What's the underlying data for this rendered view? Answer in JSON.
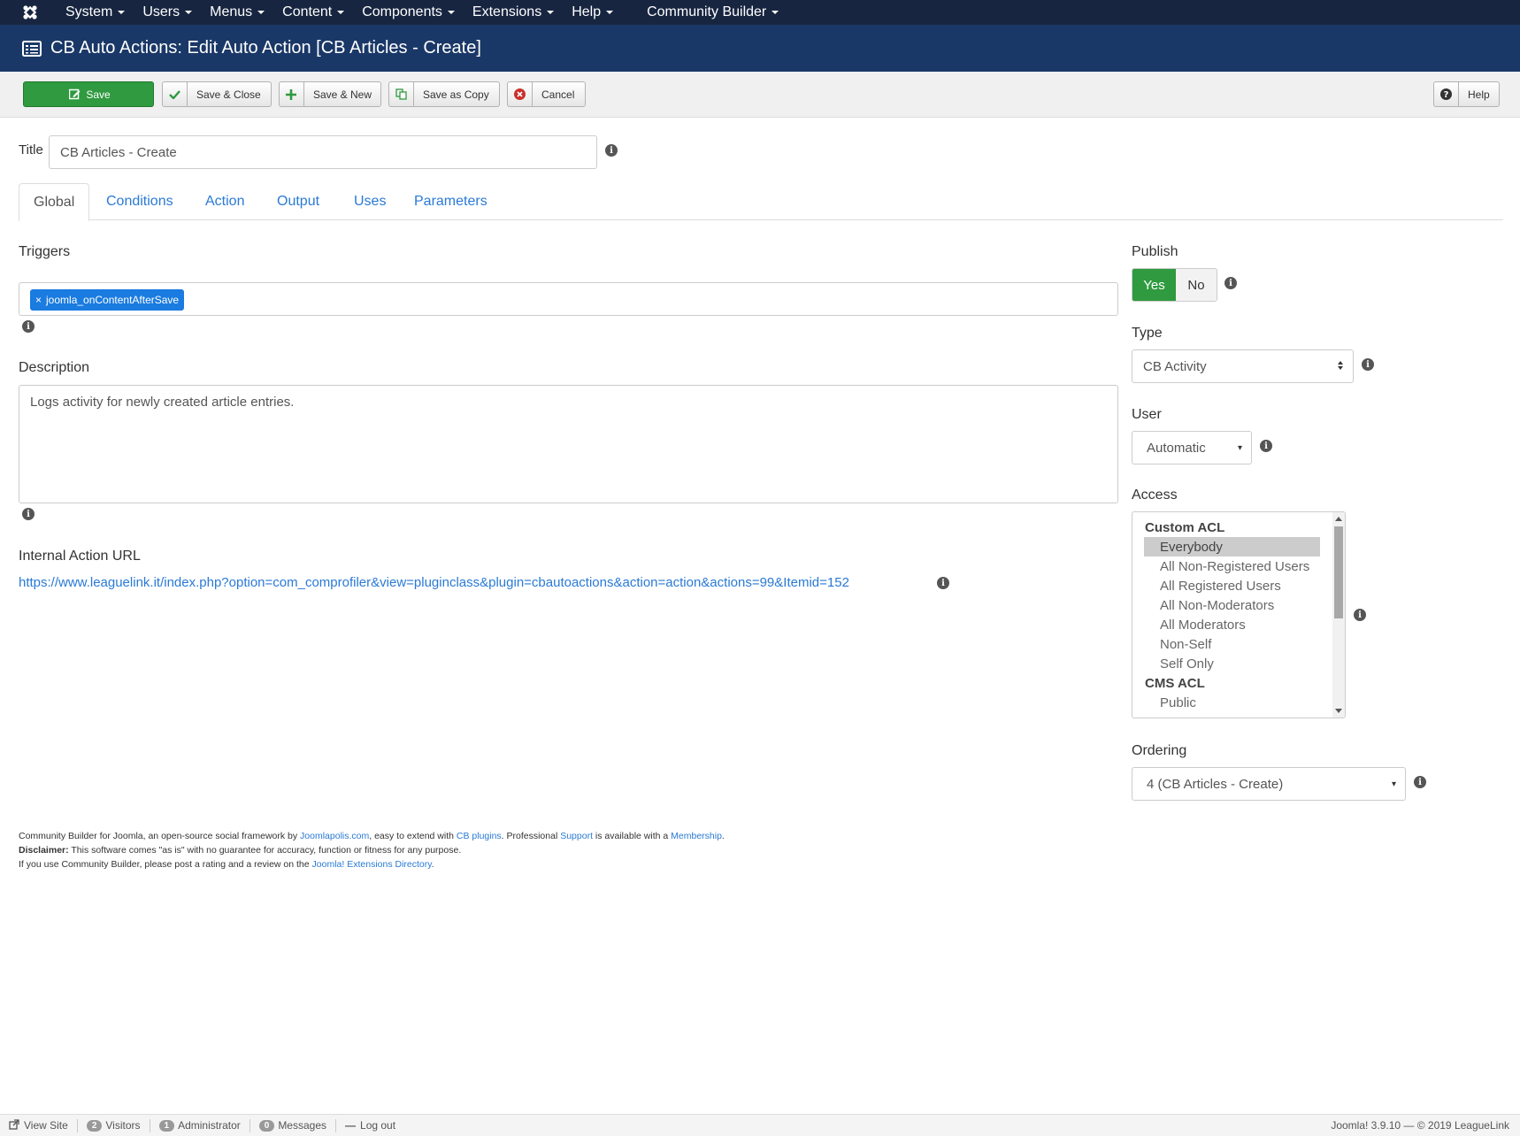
{
  "topnav": {
    "items": [
      {
        "label": "System"
      },
      {
        "label": "Users"
      },
      {
        "label": "Menus"
      },
      {
        "label": "Content"
      },
      {
        "label": "Components"
      },
      {
        "label": "Extensions"
      },
      {
        "label": "Help"
      },
      {
        "label": "Community Builder"
      }
    ]
  },
  "header": {
    "title": "CB Auto Actions: Edit Auto Action [CB Articles - Create]"
  },
  "toolbar": {
    "save_label": "Save",
    "save_close_label": "Save & Close",
    "save_new_label": "Save & New",
    "save_copy_label": "Save as Copy",
    "cancel_label": "Cancel",
    "help_label": "Help"
  },
  "form": {
    "title_label": "Title",
    "title_value": "CB Articles - Create",
    "tabs": [
      {
        "label": "Global"
      },
      {
        "label": "Conditions"
      },
      {
        "label": "Action"
      },
      {
        "label": "Output"
      },
      {
        "label": "Uses"
      },
      {
        "label": "Parameters"
      }
    ],
    "triggers_label": "Triggers",
    "trigger_tag": "joomla_onContentAfterSave",
    "description_label": "Description",
    "description_value": "Logs activity for newly created article entries.",
    "internal_url_label": "Internal Action URL",
    "internal_url": "https://www.leaguelink.it/index.php?option=com_comprofiler&view=pluginclass&plugin=cbautoactions&action=action&actions=99&Itemid=152"
  },
  "sidebar": {
    "publish_label": "Publish",
    "publish_yes": "Yes",
    "publish_no": "No",
    "type_label": "Type",
    "type_value": "CB Activity",
    "user_label": "User",
    "user_value": "Automatic",
    "access_label": "Access",
    "access_groups": [
      {
        "group": "Custom ACL",
        "options": [
          "Everybody",
          "All Non-Registered Users",
          "All Registered Users",
          "All Non-Moderators",
          "All Moderators",
          "Non-Self",
          "Self Only"
        ]
      },
      {
        "group": "CMS ACL",
        "options": [
          "Public"
        ]
      }
    ],
    "access_selected": "Everybody",
    "ordering_label": "Ordering",
    "ordering_value": "4 (CB Articles - Create)"
  },
  "footer": {
    "line1_prefix": "Community Builder for Joomla, an open-source social framework by ",
    "line1_link1": "Joomlapolis.com",
    "line1_mid1": ", easy to extend with ",
    "line1_link2": "CB plugins",
    "line1_mid2": ". Professional ",
    "line1_link3": "Support",
    "line1_mid3": " is available with a ",
    "line1_link4": "Membership",
    "line1_end": ".",
    "line2_bold": "Disclaimer:",
    "line2_text": " This software comes \"as is\" with no guarantee for accuracy, function or fitness for any purpose.",
    "line3_prefix": "If you use Community Builder, please post a rating and a review on the ",
    "line3_link": "Joomla! Extensions Directory",
    "line3_end": "."
  },
  "statusbar": {
    "view_site": "View Site",
    "visitors_count": "2",
    "visitors_label": "Visitors",
    "admin_count": "1",
    "admin_label": "Administrator",
    "messages_count": "0",
    "messages_label": "Messages",
    "logout_label": "Log out",
    "version": "Joomla! 3.9.10",
    "copyright": "© 2019 LeagueLink"
  },
  "colors": {
    "topnav_bg": "#172540",
    "header_bg": "#1a3867",
    "save_green": "#2f9a3f",
    "link_blue": "#2a7ad5",
    "tag_blue": "#1a7be0"
  }
}
